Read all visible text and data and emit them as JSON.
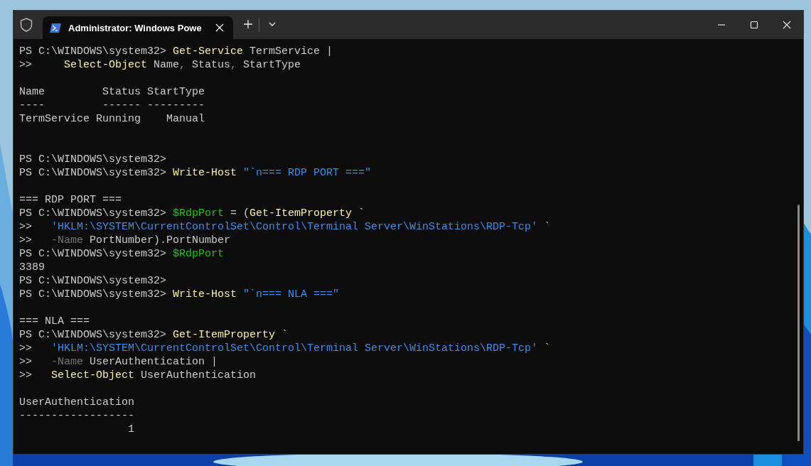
{
  "window": {
    "tabs": [
      {
        "title": "Administrator: Windows Powe",
        "selected": true
      }
    ]
  },
  "terminal": {
    "lines": [
      {
        "kind": "text",
        "segments": [
          {
            "kind": "plain",
            "text": "PS C:\\WINDOWS\\system32> "
          },
          {
            "kind": "command",
            "text": "Get-Service"
          },
          {
            "kind": "plain",
            "text": " TermService |"
          }
        ]
      },
      {
        "kind": "text",
        "segments": [
          {
            "kind": "plain",
            "text": ">>     "
          },
          {
            "kind": "command",
            "text": "Select-Object"
          },
          {
            "kind": "plain",
            "text": " Name"
          },
          {
            "kind": "punct",
            "text": ","
          },
          {
            "kind": "plain",
            "text": " Status"
          },
          {
            "kind": "punct",
            "text": ","
          },
          {
            "kind": "plain",
            "text": " StartType"
          }
        ]
      },
      {
        "kind": "blank"
      },
      {
        "kind": "text",
        "segments": [
          {
            "kind": "plain",
            "text": "Name         Status StartType"
          }
        ]
      },
      {
        "kind": "text",
        "segments": [
          {
            "kind": "plain",
            "text": "----         ------ ---------"
          }
        ]
      },
      {
        "kind": "text",
        "segments": [
          {
            "kind": "plain",
            "text": "TermService Running    Manual"
          }
        ]
      },
      {
        "kind": "blank"
      },
      {
        "kind": "blank"
      },
      {
        "kind": "text",
        "segments": [
          {
            "kind": "plain",
            "text": "PS C:\\WINDOWS\\system32>"
          }
        ]
      },
      {
        "kind": "text",
        "segments": [
          {
            "kind": "plain",
            "text": "PS C:\\WINDOWS\\system32> "
          },
          {
            "kind": "command",
            "text": "Write-Host "
          },
          {
            "kind": "string",
            "text": "\"`n=== RDP PORT ===\""
          }
        ]
      },
      {
        "kind": "blank"
      },
      {
        "kind": "text",
        "segments": [
          {
            "kind": "plain",
            "text": "=== RDP PORT ==="
          }
        ]
      },
      {
        "kind": "text",
        "segments": [
          {
            "kind": "plain",
            "text": "PS C:\\WINDOWS\\system32> "
          },
          {
            "kind": "variable",
            "text": "$RdpPort"
          },
          {
            "kind": "plain",
            "text": " = ("
          },
          {
            "kind": "command",
            "text": "Get-ItemProperty"
          },
          {
            "kind": "plain",
            "text": " `"
          }
        ]
      },
      {
        "kind": "text",
        "segments": [
          {
            "kind": "plain",
            "text": ">>   "
          },
          {
            "kind": "string",
            "text": "'HKLM:\\SYSTEM\\CurrentControlSet\\Control\\Terminal Server\\WinStations\\RDP-Tcp'"
          },
          {
            "kind": "plain",
            "text": " `"
          }
        ]
      },
      {
        "kind": "text",
        "segments": [
          {
            "kind": "plain",
            "text": ">>   "
          },
          {
            "kind": "param",
            "text": "-Name"
          },
          {
            "kind": "plain",
            "text": " PortNumber).PortNumber"
          }
        ]
      },
      {
        "kind": "text",
        "segments": [
          {
            "kind": "plain",
            "text": "PS C:\\WINDOWS\\system32> "
          },
          {
            "kind": "variable",
            "text": "$RdpPort"
          }
        ]
      },
      {
        "kind": "text",
        "segments": [
          {
            "kind": "plain",
            "text": "3389"
          }
        ]
      },
      {
        "kind": "text",
        "segments": [
          {
            "kind": "plain",
            "text": "PS C:\\WINDOWS\\system32>"
          }
        ]
      },
      {
        "kind": "text",
        "segments": [
          {
            "kind": "plain",
            "text": "PS C:\\WINDOWS\\system32> "
          },
          {
            "kind": "command",
            "text": "Write-Host "
          },
          {
            "kind": "string",
            "text": "\"`n=== NLA ===\""
          }
        ]
      },
      {
        "kind": "blank"
      },
      {
        "kind": "text",
        "segments": [
          {
            "kind": "plain",
            "text": "=== NLA ==="
          }
        ]
      },
      {
        "kind": "text",
        "segments": [
          {
            "kind": "plain",
            "text": "PS C:\\WINDOWS\\system32> "
          },
          {
            "kind": "command",
            "text": "Get-ItemProperty"
          },
          {
            "kind": "plain",
            "text": " `"
          }
        ]
      },
      {
        "kind": "text",
        "segments": [
          {
            "kind": "plain",
            "text": ">>   "
          },
          {
            "kind": "string",
            "text": "'HKLM:\\SYSTEM\\CurrentControlSet\\Control\\Terminal Server\\WinStations\\RDP-Tcp'"
          },
          {
            "kind": "plain",
            "text": " `"
          }
        ]
      },
      {
        "kind": "text",
        "segments": [
          {
            "kind": "plain",
            "text": ">>   "
          },
          {
            "kind": "param",
            "text": "-Name"
          },
          {
            "kind": "plain",
            "text": " UserAuthentication |"
          }
        ]
      },
      {
        "kind": "text",
        "segments": [
          {
            "kind": "plain",
            "text": ">>   "
          },
          {
            "kind": "command",
            "text": "Select-Object"
          },
          {
            "kind": "plain",
            "text": " UserAuthentication"
          }
        ]
      },
      {
        "kind": "blank"
      },
      {
        "kind": "text",
        "segments": [
          {
            "kind": "plain",
            "text": "UserAuthentication"
          }
        ]
      },
      {
        "kind": "text",
        "segments": [
          {
            "kind": "plain",
            "text": "------------------"
          }
        ]
      },
      {
        "kind": "text",
        "segments": [
          {
            "kind": "plain",
            "text": "                 1"
          }
        ]
      }
    ]
  }
}
